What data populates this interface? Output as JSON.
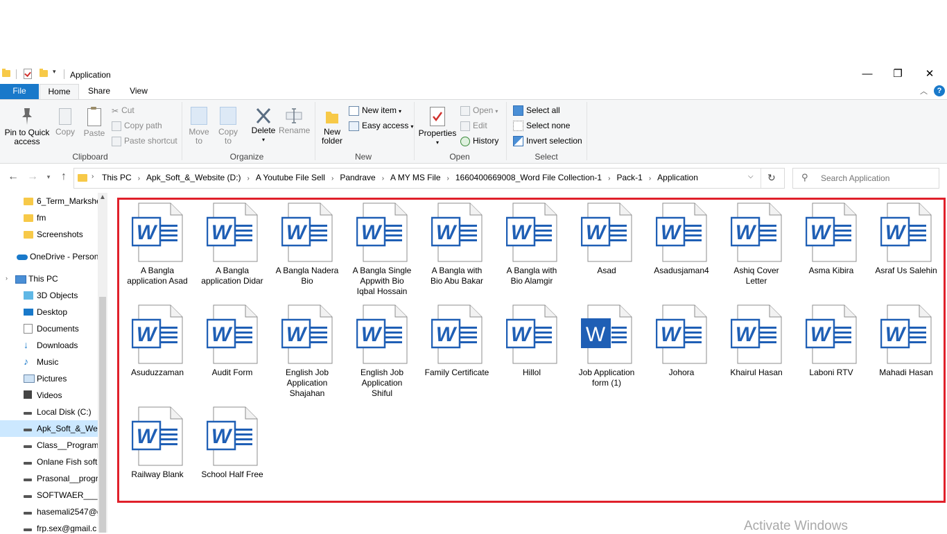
{
  "window": {
    "title": "Application",
    "minimize": "—",
    "restore": "❐",
    "close": "✕"
  },
  "tabs": [
    {
      "label": "File"
    },
    {
      "label": "Home"
    },
    {
      "label": "Share"
    },
    {
      "label": "View"
    }
  ],
  "ribbon": {
    "clipboard": {
      "label": "Clipboard",
      "pin_line1": "Pin to Quick",
      "pin_line2": "access",
      "copy": "Copy",
      "paste": "Paste",
      "cut": "Cut",
      "copy_path": "Copy path",
      "paste_shortcut": "Paste shortcut"
    },
    "organize": {
      "label": "Organize",
      "move_to_1": "Move",
      "move_to_2": "to",
      "copy_to_1": "Copy",
      "copy_to_2": "to",
      "delete": "Delete",
      "rename": "Rename"
    },
    "new": {
      "label": "New",
      "new_folder_1": "New",
      "new_folder_2": "folder",
      "new_item": "New item",
      "easy_access": "Easy access"
    },
    "open": {
      "label": "Open",
      "properties": "Properties",
      "open": "Open",
      "edit": "Edit",
      "history": "History"
    },
    "select": {
      "label": "Select",
      "select_all": "Select all",
      "select_none": "Select none",
      "invert_selection": "Invert selection"
    }
  },
  "address": {
    "crumbs": [
      "This PC",
      "Apk_Soft_&_Website (D:)",
      "A Youtube File Sell",
      "Pandrave",
      "A MY MS File",
      "1660400669008_Word File Collection-1",
      "Pack-1",
      "Application"
    ]
  },
  "search": {
    "placeholder": "Search Application"
  },
  "sidebar": {
    "items": [
      {
        "label": "6_Term_Markshe",
        "icon": "folder-icon"
      },
      {
        "label": "fm",
        "icon": "folder-icon"
      },
      {
        "label": "Screenshots",
        "icon": "folder-icon"
      },
      {
        "label": "OneDrive - Person",
        "icon": "cloud-icon"
      },
      {
        "label": "This PC",
        "icon": "computer-icon"
      },
      {
        "label": "3D Objects",
        "icon": "cube-icon"
      },
      {
        "label": "Desktop",
        "icon": "desktop-icon"
      },
      {
        "label": "Documents",
        "icon": "documents-icon"
      },
      {
        "label": "Downloads",
        "icon": "download-icon"
      },
      {
        "label": "Music",
        "icon": "music-icon"
      },
      {
        "label": "Pictures",
        "icon": "pictures-icon"
      },
      {
        "label": "Videos",
        "icon": "videos-icon"
      },
      {
        "label": "Local Disk (C:)",
        "icon": "drive-icon"
      },
      {
        "label": "Apk_Soft_&_Web",
        "icon": "drive-icon"
      },
      {
        "label": "Class__Program_",
        "icon": "drive-icon"
      },
      {
        "label": "Onlane Fish soft",
        "icon": "drive-icon"
      },
      {
        "label": "Prasonal__progra",
        "icon": "drive-icon"
      },
      {
        "label": "SOFTWAER___ (H",
        "icon": "drive-icon"
      },
      {
        "label": "hasemali2547@g",
        "icon": "drive-icon"
      },
      {
        "label": "frp.sex@gmail.c",
        "icon": "drive-icon"
      }
    ]
  },
  "files": [
    {
      "line1": "A Bangla",
      "line2": "application Asad",
      "line3": ""
    },
    {
      "line1": "A Bangla",
      "line2": "application Didar",
      "line3": ""
    },
    {
      "line1": "A Bangla Nadera",
      "line2": "Bio",
      "line3": ""
    },
    {
      "line1": "A Bangla Single",
      "line2": "Appwith Bio",
      "line3": "Iqbal Hossain"
    },
    {
      "line1": "A Bangla with",
      "line2": "Bio Abu Bakar",
      "line3": ""
    },
    {
      "line1": "A Bangla with",
      "line2": "Bio Alamgir",
      "line3": ""
    },
    {
      "line1": "Asad",
      "line2": "",
      "line3": ""
    },
    {
      "line1": "Asadusjaman4",
      "line2": "",
      "line3": ""
    },
    {
      "line1": "Ashiq Cover",
      "line2": "Letter",
      "line3": ""
    },
    {
      "line1": "Asma Kibira",
      "line2": "",
      "line3": ""
    },
    {
      "line1": "Asraf Us Salehin",
      "line2": "",
      "line3": ""
    },
    {
      "line1": "Asuduzzaman",
      "line2": "",
      "line3": ""
    },
    {
      "line1": "Audit Form",
      "line2": "",
      "line3": ""
    },
    {
      "line1": "English Job",
      "line2": "Application",
      "line3": "Shajahan"
    },
    {
      "line1": "English Job",
      "line2": "Application",
      "line3": "Shiful"
    },
    {
      "line1": "Family Certificate",
      "line2": "",
      "line3": ""
    },
    {
      "line1": "Hillol",
      "line2": "",
      "line3": ""
    },
    {
      "line1": "Job Application",
      "line2": "form (1)",
      "line3": ""
    },
    {
      "line1": "Johora",
      "line2": "",
      "line3": ""
    },
    {
      "line1": "Khairul Hasan",
      "line2": "",
      "line3": ""
    },
    {
      "line1": "Laboni RTV",
      "line2": "",
      "line3": ""
    },
    {
      "line1": "Mahadi Hasan",
      "line2": "",
      "line3": ""
    },
    {
      "line1": "Railway Blank",
      "line2": "",
      "line3": ""
    },
    {
      "line1": "School Half Free",
      "line2": "",
      "line3": ""
    }
  ],
  "watermark": "Activate Windows",
  "colors": {
    "accent": "#1979ca",
    "word_blue": "#1f5fb5",
    "highlight_border": "#e0202a",
    "selected_bg": "#cce8ff"
  }
}
